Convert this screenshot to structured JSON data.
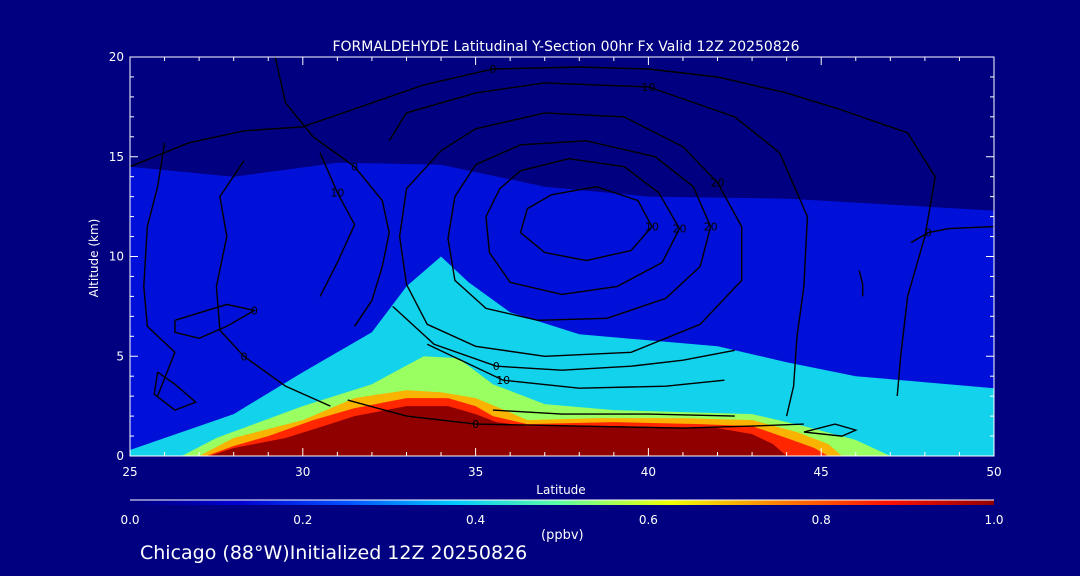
{
  "caption": "Chicago (88°W)Initialized 12Z 20250826",
  "chart_data": {
    "type": "heatmap",
    "title": "FORMALDEHYDE Latitudinal Y-Section 00hr  Fx Valid 12Z 20250826",
    "xlabel": "Latitude",
    "ylabel": "Altitude (km)",
    "xlim": [
      25,
      50
    ],
    "ylim": [
      0,
      20
    ],
    "xticks": [
      "25",
      "30",
      "35",
      "40",
      "45",
      "50"
    ],
    "yticks": [
      "0",
      "5",
      "10",
      "15",
      "20"
    ],
    "colorbar": {
      "label": "(ppbv)",
      "range": [
        0.0,
        1.0
      ],
      "ticks": [
        "0.0",
        "0.2",
        "0.4",
        "0.6",
        "0.8",
        "1.0"
      ],
      "colors": [
        "#000080",
        "#0000d0",
        "#0050ff",
        "#00c8ff",
        "#60ffa0",
        "#f0ff00",
        "#ff8000",
        "#ff1000",
        "#900000"
      ]
    },
    "filled_regions": [
      {
        "level": 0.3,
        "polygon": [
          [
            25,
            6.8
          ],
          [
            26,
            6.6
          ],
          [
            29,
            6.7
          ],
          [
            31,
            7.8
          ],
          [
            33,
            9.5
          ],
          [
            35,
            10.8
          ],
          [
            37,
            11.5
          ],
          [
            40,
            11.2
          ],
          [
            43,
            8.5
          ],
          [
            45,
            6
          ],
          [
            48,
            4.5
          ],
          [
            50,
            4.2
          ],
          [
            50,
            0
          ],
          [
            25,
            0
          ]
        ]
      },
      {
        "level": 0.2,
        "polygon": [
          [
            25,
            11.6
          ],
          [
            27,
            10.6
          ],
          [
            29,
            12.2
          ],
          [
            31,
            13.7
          ],
          [
            33,
            14.2
          ],
          [
            35,
            14
          ],
          [
            37,
            13
          ],
          [
            40,
            12
          ],
          [
            43,
            11.6
          ],
          [
            46,
            12.3
          ],
          [
            48,
            11.8
          ],
          [
            50,
            11.6
          ],
          [
            50,
            0
          ],
          [
            25,
            0
          ]
        ]
      },
      {
        "level": 0.15,
        "polygon": [
          [
            25,
            14.5
          ],
          [
            28,
            14
          ],
          [
            31,
            14.7
          ],
          [
            34,
            14.6
          ],
          [
            37,
            13.5
          ],
          [
            40,
            13
          ],
          [
            44,
            12.9
          ],
          [
            48,
            12.5
          ],
          [
            50,
            12.3
          ],
          [
            50,
            0
          ],
          [
            25,
            0
          ]
        ]
      },
      {
        "level": 0.4,
        "polygon": [
          [
            25,
            0.3
          ],
          [
            28,
            2.1
          ],
          [
            30,
            4.2
          ],
          [
            32,
            6.2
          ],
          [
            33,
            8.5
          ],
          [
            34,
            10
          ],
          [
            34.8,
            8.7
          ],
          [
            36,
            7.2
          ],
          [
            38,
            6.1
          ],
          [
            40,
            5.8
          ],
          [
            42,
            5.5
          ],
          [
            44,
            4.7
          ],
          [
            46,
            4
          ],
          [
            48,
            3.7
          ],
          [
            50,
            3.4
          ],
          [
            50,
            0
          ],
          [
            25,
            0
          ]
        ]
      },
      {
        "level": 0.55,
        "polygon": [
          [
            26.5,
            0
          ],
          [
            27.5,
            0.9
          ],
          [
            30,
            2.5
          ],
          [
            32,
            3.6
          ],
          [
            33.5,
            5
          ],
          [
            34.5,
            4.9
          ],
          [
            35.5,
            3.6
          ],
          [
            37,
            2.6
          ],
          [
            39,
            2.3
          ],
          [
            41,
            2.2
          ],
          [
            43,
            2.1
          ],
          [
            44.5,
            1.5
          ],
          [
            46,
            0.8
          ],
          [
            47,
            0
          ],
          [
            26.5,
            0
          ]
        ]
      },
      {
        "level": 0.7,
        "polygon": [
          [
            27,
            0
          ],
          [
            28,
            0.9
          ],
          [
            30,
            1.8
          ],
          [
            31.5,
            2.9
          ],
          [
            33,
            3.3
          ],
          [
            34,
            3.2
          ],
          [
            35,
            2.9
          ],
          [
            35.7,
            2.4
          ],
          [
            36.5,
            1.8
          ],
          [
            38.5,
            1.9
          ],
          [
            41,
            1.9
          ],
          [
            43,
            1.8
          ],
          [
            44.3,
            1.2
          ],
          [
            45.2,
            0.6
          ],
          [
            45.6,
            0
          ],
          [
            27,
            0
          ]
        ]
      },
      {
        "level": 0.85,
        "polygon": [
          [
            27.2,
            0
          ],
          [
            28,
            0.5
          ],
          [
            29,
            1
          ],
          [
            30.3,
            1.8
          ],
          [
            31.5,
            2.4
          ],
          [
            33,
            2.9
          ],
          [
            34.2,
            2.9
          ],
          [
            35,
            2.5
          ],
          [
            35.5,
            2
          ],
          [
            36.5,
            1.6
          ],
          [
            39,
            1.7
          ],
          [
            41.5,
            1.6
          ],
          [
            43,
            1.5
          ],
          [
            44,
            0.9
          ],
          [
            44.8,
            0.4
          ],
          [
            45.2,
            0
          ],
          [
            27.2,
            0
          ]
        ]
      },
      {
        "level": 1.0,
        "polygon": [
          [
            27.3,
            0
          ],
          [
            28,
            0.4
          ],
          [
            29.5,
            0.9
          ],
          [
            30.6,
            1.5
          ],
          [
            31.5,
            2
          ],
          [
            33,
            2.5
          ],
          [
            34.2,
            2.5
          ],
          [
            35,
            2.1
          ],
          [
            35.6,
            1.7
          ],
          [
            36.5,
            1.5
          ],
          [
            39,
            1.5
          ],
          [
            42,
            1.4
          ],
          [
            43,
            1.1
          ],
          [
            43.6,
            0.6
          ],
          [
            44,
            0
          ],
          [
            27.3,
            0
          ]
        ]
      }
    ],
    "contours": [
      {
        "label": "0",
        "points": [
          [
            25,
            14.5
          ],
          [
            26.7,
            15.7
          ],
          [
            28.3,
            16.3
          ],
          [
            30,
            16.5
          ],
          [
            31.5,
            17.4
          ],
          [
            33.5,
            18.6
          ],
          [
            35.5,
            19.4
          ],
          [
            38,
            19.5
          ],
          [
            40,
            19.4
          ],
          [
            42,
            19
          ],
          [
            44,
            18.2
          ],
          [
            45.5,
            17.4
          ],
          [
            47.5,
            16.2
          ],
          [
            48.3,
            14
          ],
          [
            48,
            11
          ],
          [
            47.5,
            8
          ],
          [
            47.3,
            5
          ],
          [
            47.2,
            3
          ]
        ]
      },
      {
        "label": "10",
        "points": [
          [
            32.5,
            15.8
          ],
          [
            33,
            17.2
          ],
          [
            35,
            18.2
          ],
          [
            37,
            18.7
          ],
          [
            40,
            18.5
          ],
          [
            42.5,
            17
          ],
          [
            43.8,
            15.2
          ],
          [
            44.6,
            12
          ],
          [
            44.5,
            8.5
          ],
          [
            44.3,
            6
          ],
          [
            44.2,
            3.5
          ],
          [
            44,
            2
          ]
        ]
      },
      {
        "label": "20",
        "points": [
          [
            34,
            15.3
          ],
          [
            35,
            16.4
          ],
          [
            37,
            17.2
          ],
          [
            39.3,
            17
          ],
          [
            41,
            15.5
          ],
          [
            42,
            13.7
          ],
          [
            42.7,
            11.5
          ],
          [
            42.7,
            8.8
          ],
          [
            41.5,
            6.6
          ],
          [
            39.5,
            5.2
          ],
          [
            37,
            5
          ],
          [
            35,
            5.5
          ],
          [
            33.6,
            6.6
          ],
          [
            33,
            8.6
          ],
          [
            32.8,
            11
          ],
          [
            33,
            13.4
          ],
          [
            34,
            15.3
          ]
        ]
      },
      {
        "label": "20",
        "points": [
          [
            35,
            14.6
          ],
          [
            36.3,
            15.6
          ],
          [
            38.2,
            15.8
          ],
          [
            40.2,
            15
          ],
          [
            41.3,
            13.5
          ],
          [
            41.8,
            11.5
          ],
          [
            41.5,
            9.5
          ],
          [
            40.5,
            7.9
          ],
          [
            38.8,
            6.9
          ],
          [
            36.8,
            6.8
          ],
          [
            35.3,
            7.4
          ],
          [
            34.4,
            8.8
          ],
          [
            34.2,
            10.9
          ],
          [
            34.4,
            13
          ],
          [
            35,
            14.6
          ]
        ]
      },
      {
        "label": "20",
        "points": [
          [
            36.3,
            14.3
          ],
          [
            37.7,
            14.9
          ],
          [
            39.3,
            14.5
          ],
          [
            40.3,
            13.2
          ],
          [
            40.9,
            11.4
          ],
          [
            40.4,
            9.7
          ],
          [
            39.1,
            8.5
          ],
          [
            37.5,
            8.1
          ],
          [
            36,
            8.7
          ],
          [
            35.4,
            10.2
          ],
          [
            35.3,
            12
          ],
          [
            35.7,
            13.4
          ],
          [
            36.3,
            14.3
          ]
        ]
      },
      {
        "label": "10",
        "points": [
          [
            37.2,
            13.1
          ],
          [
            38.5,
            13.5
          ],
          [
            39.7,
            12.8
          ],
          [
            40.1,
            11.5
          ],
          [
            39.5,
            10.3
          ],
          [
            38.2,
            9.8
          ],
          [
            37,
            10.2
          ],
          [
            36.3,
            11.2
          ],
          [
            36.5,
            12.4
          ],
          [
            37.2,
            13.1
          ]
        ]
      },
      {
        "label": "0",
        "points": [
          [
            29.2,
            20
          ],
          [
            29.5,
            17.7
          ],
          [
            30.3,
            16
          ],
          [
            31.5,
            14.5
          ],
          [
            32.3,
            12.8
          ],
          [
            32.5,
            11.2
          ],
          [
            32.3,
            9.5
          ],
          [
            32,
            7.8
          ],
          [
            31.5,
            6.5
          ]
        ]
      },
      {
        "label": "10",
        "points": [
          [
            30.5,
            15.2
          ],
          [
            31,
            13.2
          ],
          [
            31.5,
            11.6
          ],
          [
            31,
            9.7
          ],
          [
            30.5,
            8
          ]
        ]
      },
      {
        "label": "0",
        "points": [
          [
            32.6,
            7.5
          ],
          [
            33.8,
            5.6
          ],
          [
            35.6,
            4.5
          ],
          [
            37.5,
            4.3
          ],
          [
            39.5,
            4.5
          ],
          [
            41,
            4.8
          ],
          [
            42.5,
            5.3
          ]
        ]
      },
      {
        "label": "10",
        "points": [
          [
            33.6,
            5.6
          ],
          [
            35.8,
            3.8
          ],
          [
            38,
            3.4
          ],
          [
            40.5,
            3.5
          ],
          [
            42.2,
            3.8
          ]
        ]
      },
      {
        "label": "0",
        "points": [
          [
            31.3,
            2.8
          ],
          [
            33,
            2
          ],
          [
            35,
            1.6
          ],
          [
            38,
            1.5
          ],
          [
            41,
            1.4
          ],
          [
            43,
            1.5
          ],
          [
            44.5,
            1.6
          ]
        ]
      },
      {
        "label": "",
        "points": [
          [
            35.5,
            2.3
          ],
          [
            37.5,
            2.1
          ],
          [
            40,
            2.1
          ],
          [
            42.5,
            2
          ]
        ]
      },
      {
        "label": "0",
        "points": [
          [
            30.8,
            2.5
          ],
          [
            29.5,
            3.5
          ],
          [
            28.3,
            5
          ],
          [
            27.6,
            6.3
          ],
          [
            27.5,
            8.5
          ],
          [
            27.8,
            11
          ],
          [
            27.6,
            13
          ],
          [
            28.3,
            14.8
          ]
        ]
      },
      {
        "label": "0",
        "points": [
          [
            26.3,
            6.8
          ],
          [
            27.8,
            7.6
          ],
          [
            28.6,
            7.3
          ],
          [
            27.8,
            6.5
          ],
          [
            27,
            5.9
          ],
          [
            26.3,
            6.2
          ],
          [
            26.3,
            6.8
          ]
        ]
      },
      {
        "label": "",
        "points": [
          [
            26,
            15.7
          ],
          [
            25.8,
            13.5
          ],
          [
            25.5,
            11.5
          ],
          [
            25.4,
            8.5
          ],
          [
            25.5,
            6.5
          ],
          [
            26.3,
            5.2
          ],
          [
            25.8,
            3
          ]
        ]
      },
      {
        "label": "",
        "points": [
          [
            25.8,
            4.2
          ],
          [
            26.3,
            3.6
          ],
          [
            26.9,
            2.7
          ],
          [
            26.3,
            2.3
          ],
          [
            25.7,
            3.1
          ],
          [
            25.8,
            4.2
          ]
        ]
      },
      {
        "label": "",
        "points": [
          [
            44.5,
            1.2
          ],
          [
            45.4,
            1.6
          ],
          [
            46,
            1.3
          ],
          [
            45.6,
            1
          ],
          [
            44.5,
            1.2
          ]
        ]
      },
      {
        "label": "",
        "points": [
          [
            46.1,
            9.3
          ],
          [
            46.2,
            8.6
          ],
          [
            46.2,
            8
          ]
        ]
      },
      {
        "label": "0",
        "points": [
          [
            47.6,
            10.7
          ],
          [
            48.1,
            11.2
          ],
          [
            48.7,
            11.4
          ],
          [
            50,
            11.5
          ]
        ]
      }
    ]
  }
}
